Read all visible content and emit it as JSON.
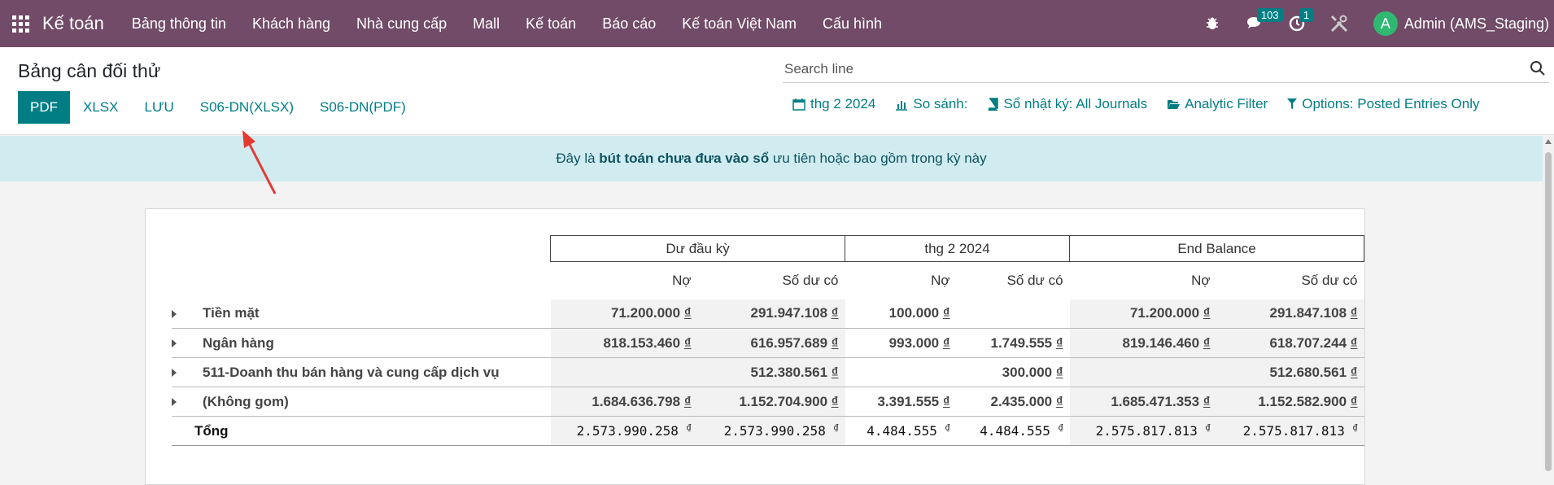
{
  "navbar": {
    "brand": "Kế toán",
    "menu": [
      "Bảng thông tin",
      "Khách hàng",
      "Nhà cung cấp",
      "Mall",
      "Kế toán",
      "Báo cáo",
      "Kế toán Việt Nam",
      "Cấu hình"
    ],
    "messages_count": "103",
    "activities_count": "1",
    "avatar_letter": "A",
    "user": "Admin (AMS_Staging)"
  },
  "control": {
    "title": "Bảng cân đối thử",
    "search_placeholder": "Search line",
    "buttons": [
      "PDF",
      "XLSX",
      "LƯU",
      "S06-DN(XLSX)",
      "S06-DN(PDF)"
    ],
    "filters": {
      "date": "thg 2 2024",
      "compare": "So sánh:",
      "journals": "Sổ nhật ký: All Journals",
      "analytic": "Analytic Filter",
      "options": "Options: Posted Entries Only"
    }
  },
  "banner": {
    "prefix": "Đây là ",
    "bold": "bút toán chưa đưa vào sổ",
    "suffix": " ưu tiên hoặc bao gồm trong kỳ này"
  },
  "report": {
    "groups": [
      "Dư đầu kỳ",
      "thg 2 2024",
      "End Balance"
    ],
    "sub_headers": [
      "Nợ",
      "Số dư có",
      "Nợ",
      "Số dư có",
      "Nợ",
      "Số dư có"
    ],
    "currency": "₫",
    "rows": [
      {
        "name": "Tiền mặt",
        "values": [
          "71.200.000",
          "291.947.108",
          "100.000",
          "",
          "71.200.000",
          "291.847.108"
        ]
      },
      {
        "name": "Ngân hàng",
        "values": [
          "818.153.460",
          "616.957.689",
          "993.000",
          "1.749.555",
          "819.146.460",
          "618.707.244"
        ]
      },
      {
        "name": "511-Doanh thu bán hàng và cung cấp dịch vụ",
        "values": [
          "",
          "512.380.561",
          "",
          "300.000",
          "",
          "512.680.561"
        ]
      },
      {
        "name": "(Không gom)",
        "values": [
          "1.684.636.798",
          "1.152.704.900",
          "3.391.555",
          "2.435.000",
          "1.685.471.353",
          "1.152.582.900"
        ]
      }
    ],
    "total": {
      "label": "Tổng",
      "values": [
        "2.573.990.258",
        "2.573.990.258",
        "4.484.555",
        "4.484.555",
        "2.575.817.813",
        "2.575.817.813"
      ]
    }
  }
}
